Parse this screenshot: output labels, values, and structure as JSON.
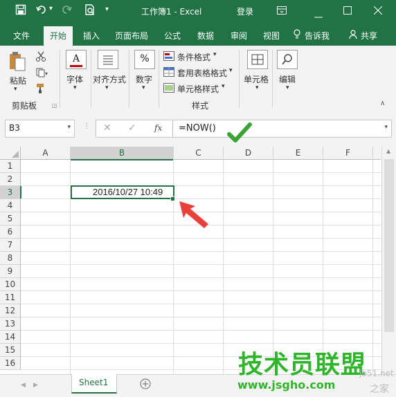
{
  "title_bar": {
    "doc_title": "工作簿1  -  Excel",
    "login": "登录"
  },
  "tabs": [
    {
      "label": "文件"
    },
    {
      "label": "开始"
    },
    {
      "label": "插入"
    },
    {
      "label": "页面布局"
    },
    {
      "label": "公式"
    },
    {
      "label": "数据"
    },
    {
      "label": "审阅"
    },
    {
      "label": "视图"
    }
  ],
  "tell_me": "告诉我",
  "share": "共享",
  "ribbon": {
    "paste": "粘贴",
    "clipboard_group": "剪贴板",
    "font": "字体",
    "alignment": "对齐方式",
    "number": "数字",
    "conditional_format": "条件格式",
    "table_format": "套用表格格式",
    "cell_styles": "单元格样式",
    "styles_group": "样式",
    "cells": "单元格",
    "editing": "编辑"
  },
  "formula_bar": {
    "name_box": "B3",
    "formula": "=NOW()",
    "fx": "fx"
  },
  "grid": {
    "columns": [
      "A",
      "B",
      "C",
      "D",
      "E",
      "F"
    ],
    "rows": [
      "1",
      "2",
      "3",
      "4",
      "5",
      "6",
      "7",
      "8",
      "9",
      "10",
      "11",
      "12",
      "13",
      "14",
      "15",
      "16"
    ],
    "cell_b3": "2016/10/27 10:49"
  },
  "sheet_tab": "Sheet1",
  "watermark": {
    "brand": "技术员联盟",
    "url": "www.jsgho.com",
    "corner": "jb51.net",
    "corner2": "之家"
  },
  "colors": {
    "excel_green": "#217346",
    "check_green": "#3aa335",
    "arrow_red": "#e8413c",
    "watermark_green": "#2fb52a"
  }
}
